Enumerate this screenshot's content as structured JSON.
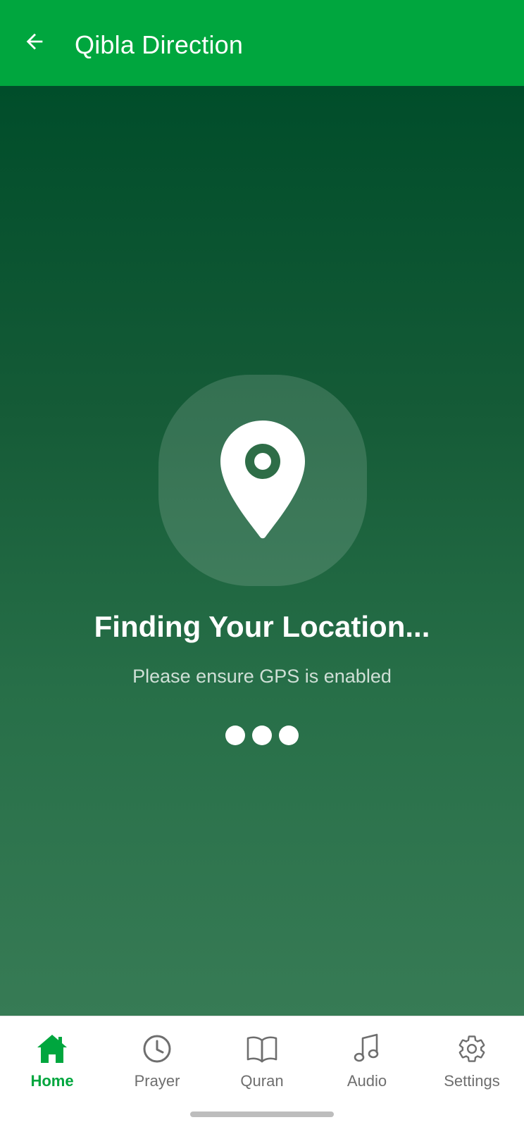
{
  "app_bar": {
    "title": "Qibla Direction",
    "back_icon": "arrow-left-icon",
    "background_color": "#00A63E"
  },
  "status": {
    "icon": "location-pin-icon",
    "title": "Finding Your Location...",
    "subtitle": "Please ensure GPS is enabled",
    "loading_dots": 3
  },
  "bottom_nav": {
    "accent_color": "#00A63E",
    "items": [
      {
        "label": "Home",
        "icon": "home-icon",
        "active": true
      },
      {
        "label": "Prayer",
        "icon": "clock-icon",
        "active": false
      },
      {
        "label": "Quran",
        "icon": "book-icon",
        "active": false
      },
      {
        "label": "Audio",
        "icon": "music-note-icon",
        "active": false
      },
      {
        "label": "Settings",
        "icon": "gear-icon",
        "active": false
      }
    ]
  }
}
